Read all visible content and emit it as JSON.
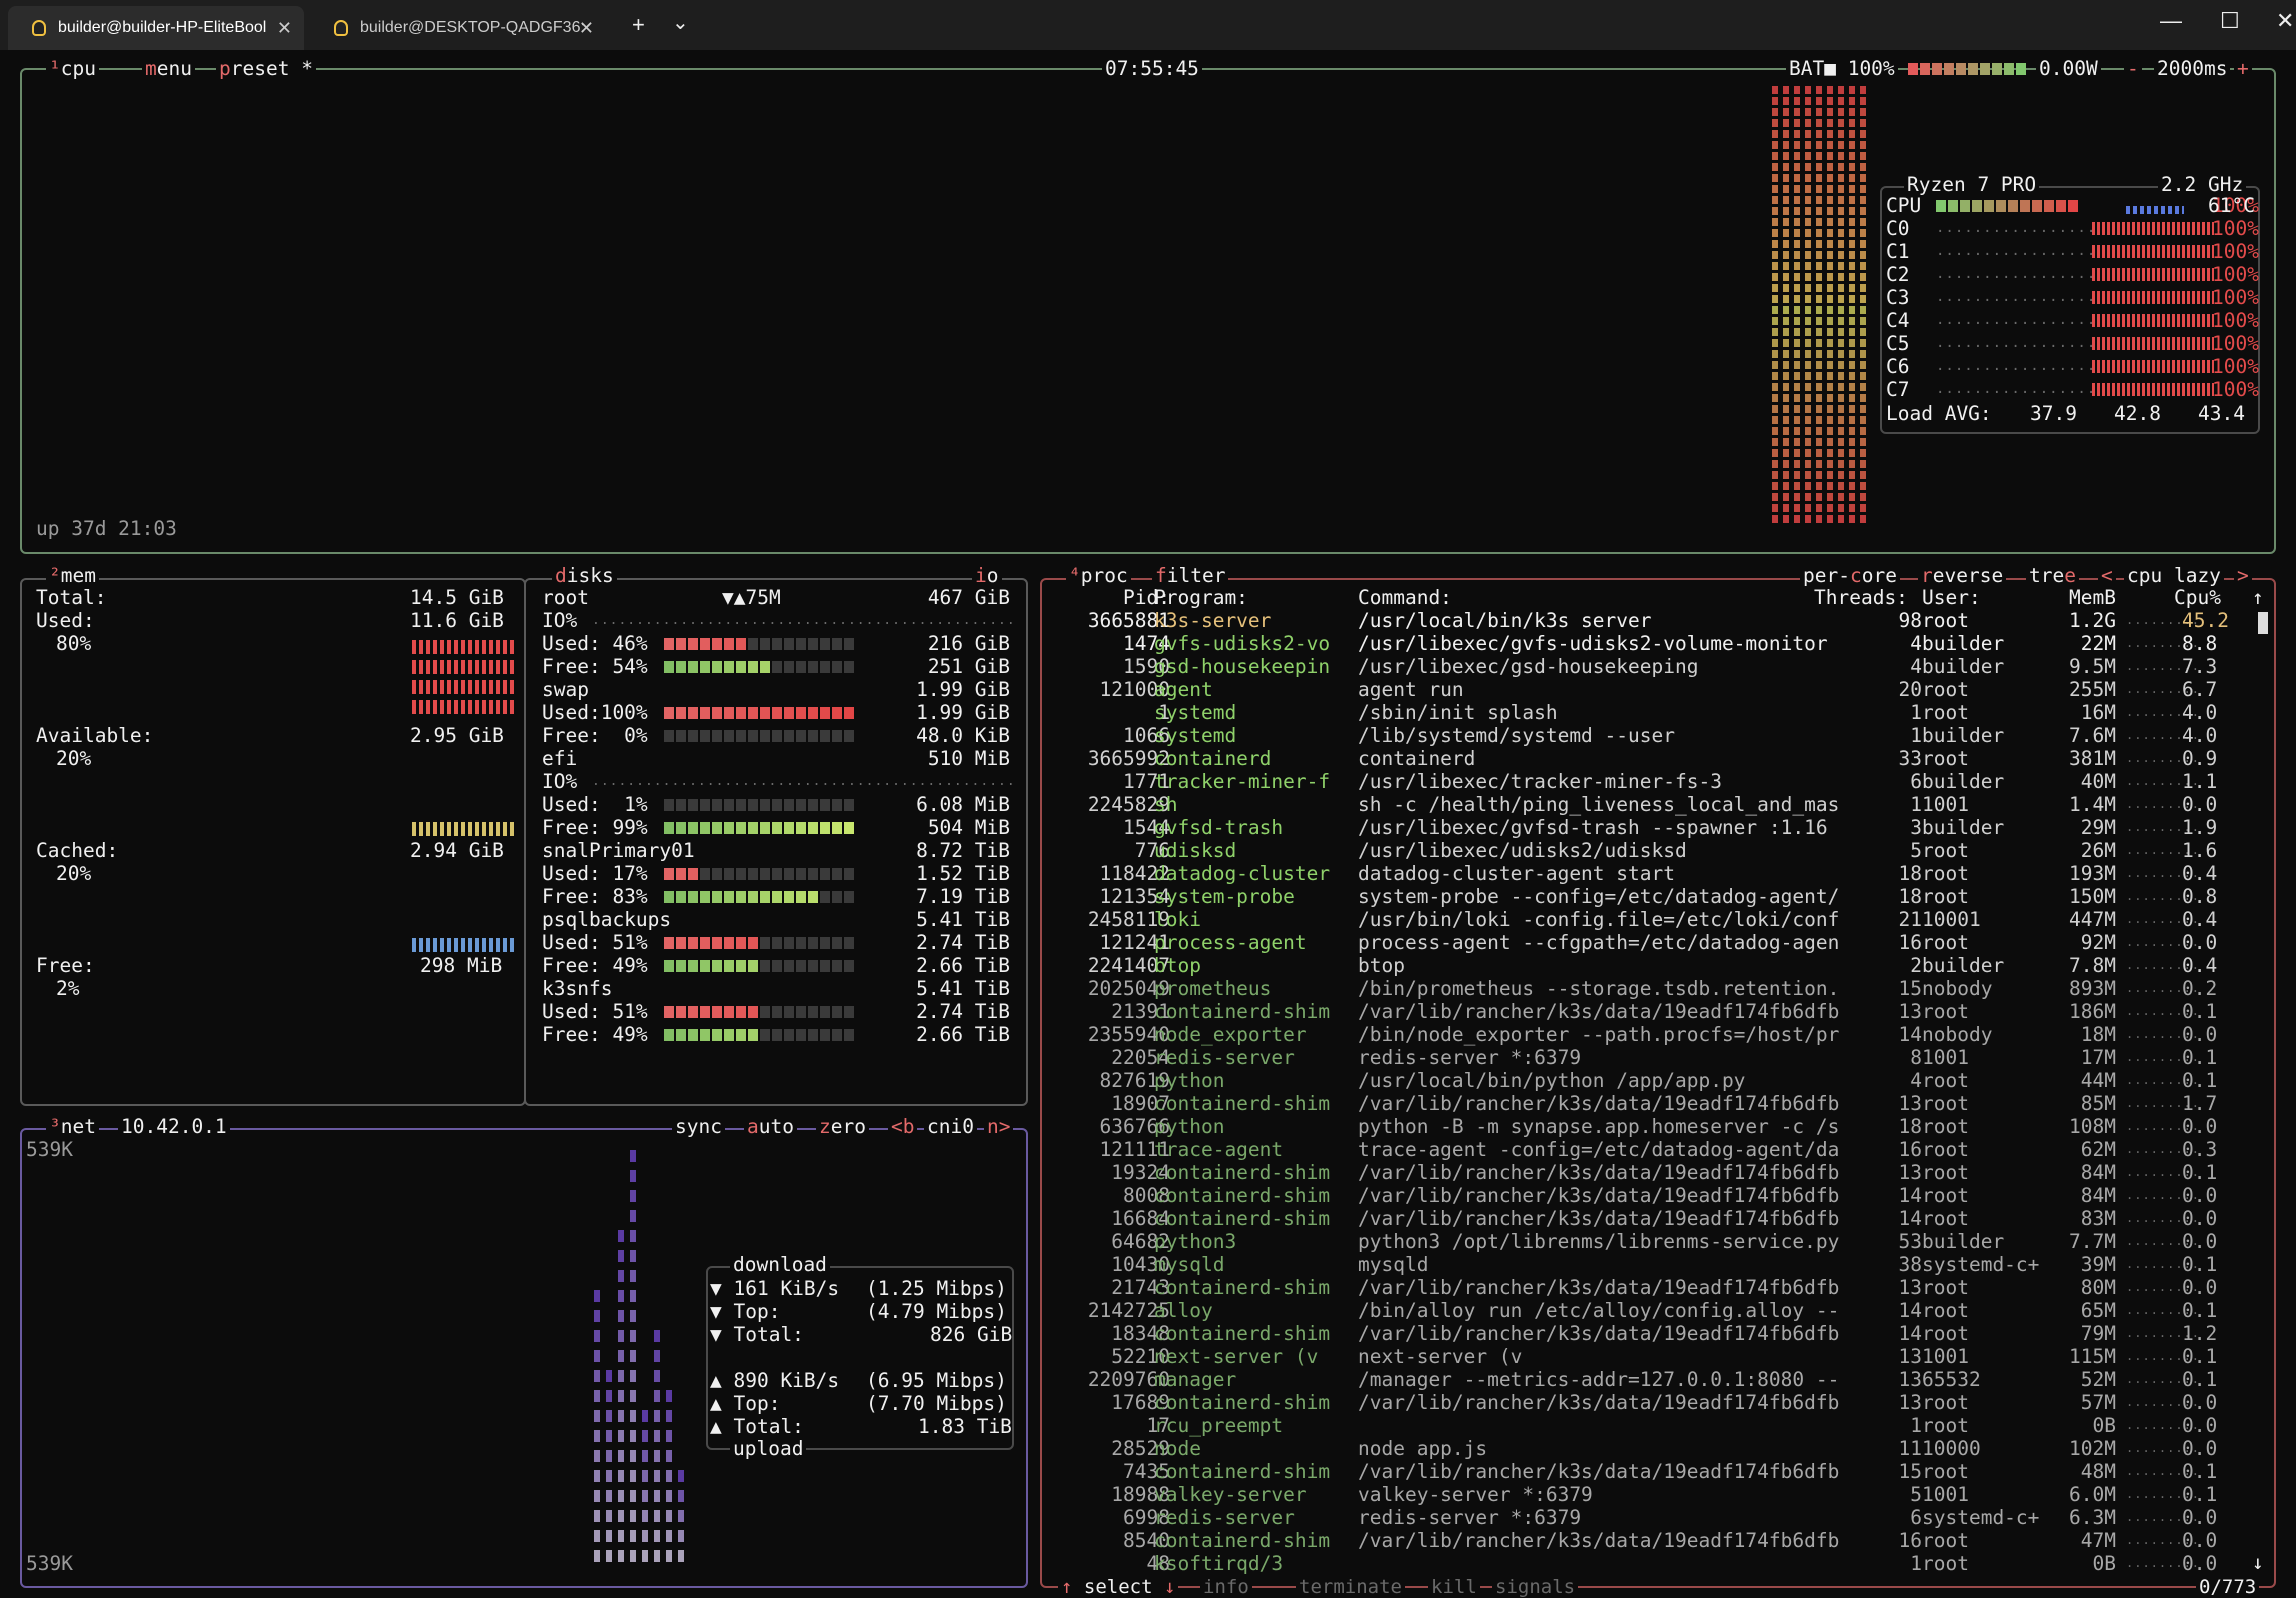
{
  "tabs": [
    {
      "label": "builder@builder-HP-EliteBool",
      "active": true
    },
    {
      "label": "builder@DESKTOP-QADGF36:",
      "active": false
    }
  ],
  "window": {
    "minimize": "—",
    "maximize": "☐",
    "close": "✕",
    "new_tab": "+",
    "dropdown": "⌄"
  },
  "cpu": {
    "title": "cpu",
    "menu": "menu",
    "preset": "preset *",
    "clock": "07:55:45",
    "battery": "BAT■ 100%",
    "power": "0.00W",
    "interval": "2000ms",
    "minus": "-",
    "plus": "+",
    "uptime": "up 37d 21:03",
    "model": "Ryzen 7 PRO",
    "freq": "2.2 GHz",
    "total_label": "CPU",
    "total_pct": "100%",
    "total_temp": "61°C",
    "cores": [
      {
        "name": "C0",
        "pct": "100%"
      },
      {
        "name": "C1",
        "pct": "100%"
      },
      {
        "name": "C2",
        "pct": "100%"
      },
      {
        "name": "C3",
        "pct": "100%"
      },
      {
        "name": "C4",
        "pct": "100%"
      },
      {
        "name": "C5",
        "pct": "100%"
      },
      {
        "name": "C6",
        "pct": "100%"
      },
      {
        "name": "C7",
        "pct": "100%"
      }
    ],
    "load_label": "Load AVG:",
    "load": [
      "37.9",
      "42.8",
      "43.4"
    ]
  },
  "mem": {
    "title": "mem",
    "total_label": "Total:",
    "total": "14.5 GiB",
    "used_label": "Used:",
    "used": "11.6 GiB",
    "used_pct": "80%",
    "avail_label": "Available:",
    "avail": "2.95 GiB",
    "avail_pct": "20%",
    "cached_label": "Cached:",
    "cached": "2.94 GiB",
    "cached_pct": "20%",
    "free_label": "Free:",
    "free": "298 MiB",
    "free_pct": "2%"
  },
  "disks": {
    "title": "disks",
    "io": "io",
    "root": {
      "name": "root",
      "io_speed": "▼▲75M",
      "size": "467 GiB",
      "io": "IO%",
      "used": "Used: 46%",
      "used_val": "216 GiB",
      "free": "Free: 54%",
      "free_val": "251 GiB",
      "used_frac": 0.46,
      "free_frac": 0.54
    },
    "swap": {
      "name": "swap",
      "size": "1.99 GiB",
      "used": "Used:100%",
      "used_val": "1.99 GiB",
      "free": "Free:  0%",
      "free_val": "48.0 KiB",
      "used_frac": 1.0,
      "free_frac": 0.0
    },
    "efi": {
      "name": "efi",
      "size": "510 MiB",
      "io": "IO%",
      "used": "Used:  1%",
      "used_val": "6.08 MiB",
      "free": "Free: 99%",
      "free_val": "504 MiB",
      "used_frac": 0.01,
      "free_frac": 0.99
    },
    "snal": {
      "name": "snalPrimary01",
      "size": "8.72 TiB",
      "used": "Used: 17%",
      "used_val": "1.52 TiB",
      "free": "Free: 83%",
      "free_val": "7.19 TiB",
      "used_frac": 0.17,
      "free_frac": 0.83
    },
    "psql": {
      "name": "psqlbackups",
      "size": "5.41 TiB",
      "used": "Used: 51%",
      "used_val": "2.74 TiB",
      "free": "Free: 49%",
      "free_val": "2.66 TiB",
      "used_frac": 0.51,
      "free_frac": 0.49
    },
    "k3s": {
      "name": "k3snfs",
      "size": "5.41 TiB",
      "used": "Used: 51%",
      "used_val": "2.74 TiB",
      "free": "Free: 49%",
      "free_val": "2.66 TiB",
      "used_frac": 0.51,
      "free_frac": 0.49
    }
  },
  "net": {
    "title": "net",
    "ip": "10.42.0.1",
    "sync": "sync",
    "auto": "auto",
    "zero": "zero",
    "prev": "<b",
    "iface": "cni0",
    "next": "n>",
    "scale_top": "539K",
    "scale_bottom": "539K",
    "download_label": "download",
    "dl_rate": "161 KiB/s",
    "dl_rate_bits": "(1.25 Mibps)",
    "dl_top_label": "Top:",
    "dl_top": "(4.79 Mibps)",
    "dl_total_label": "Total:",
    "dl_total": "826 GiB",
    "ul_rate": "890 KiB/s",
    "ul_rate_bits": "(6.95 Mibps)",
    "ul_top_label": "Top:",
    "ul_top": "(7.70 Mibps)",
    "ul_total_label": "Total:",
    "ul_total": "1.83 TiB",
    "upload_label": "upload"
  },
  "proc": {
    "title": "proc",
    "filter": "filter",
    "percore": "per-core",
    "reverse": "reverse",
    "tree": "tree",
    "sort": "cpu lazy",
    "sort_prev": "<",
    "sort_next": ">",
    "headers": {
      "pid": "Pid:",
      "program": "Program:",
      "command": "Command:",
      "threads": "Threads:",
      "user": "User:",
      "mem": "MemB",
      "cpu": "Cpu%"
    },
    "rows": [
      [
        "3665881",
        "k3s-server",
        "/usr/local/bin/k3s server",
        "98",
        "root",
        "1.2G",
        "45.2"
      ],
      [
        "1474",
        "gvfs-udisks2-vo",
        "/usr/libexec/gvfs-udisks2-volume-monitor",
        "4",
        "builder",
        "22M",
        "8.8"
      ],
      [
        "1590",
        "gsd-housekeepin",
        "/usr/libexec/gsd-housekeeping",
        "4",
        "builder",
        "9.5M",
        "7.3"
      ],
      [
        "121000",
        "agent",
        "agent run",
        "20",
        "root",
        "255M",
        "6.7"
      ],
      [
        "1",
        "systemd",
        "/sbin/init splash",
        "1",
        "root",
        "16M",
        "4.0"
      ],
      [
        "1066",
        "systemd",
        "/lib/systemd/systemd --user",
        "1",
        "builder",
        "7.6M",
        "4.0"
      ],
      [
        "3665992",
        "containerd",
        "containerd",
        "33",
        "root",
        "381M",
        "0.9"
      ],
      [
        "1771",
        "tracker-miner-f",
        "/usr/libexec/tracker-miner-fs-3",
        "6",
        "builder",
        "40M",
        "1.1"
      ],
      [
        "2245829",
        "sh",
        "sh -c /health/ping_liveness_local_and_mas",
        "1",
        "1001",
        "1.4M",
        "0.0"
      ],
      [
        "1544",
        "gvfsd-trash",
        "/usr/libexec/gvfsd-trash --spawner :1.16",
        "3",
        "builder",
        "29M",
        "1.9"
      ],
      [
        "776",
        "udisksd",
        "/usr/libexec/udisks2/udisksd",
        "5",
        "root",
        "26M",
        "1.6"
      ],
      [
        "118422",
        "datadog-cluster",
        "datadog-cluster-agent start",
        "18",
        "root",
        "193M",
        "0.4"
      ],
      [
        "121354",
        "system-probe",
        "system-probe --config=/etc/datadog-agent/",
        "18",
        "root",
        "150M",
        "0.8"
      ],
      [
        "2458119",
        "loki",
        "/usr/bin/loki -config.file=/etc/loki/conf",
        "21",
        "10001",
        "447M",
        "0.4"
      ],
      [
        "121241",
        "process-agent",
        "process-agent --cfgpath=/etc/datadog-agen",
        "16",
        "root",
        "92M",
        "0.0"
      ],
      [
        "2241407",
        "btop",
        "btop",
        "2",
        "builder",
        "7.8M",
        "0.4"
      ],
      [
        "2025049",
        "prometheus",
        "/bin/prometheus --storage.tsdb.retention.",
        "15",
        "nobody",
        "893M",
        "0.2"
      ],
      [
        "21391",
        "containerd-shim",
        "/var/lib/rancher/k3s/data/19eadf174fb6dfb",
        "13",
        "root",
        "186M",
        "0.1"
      ],
      [
        "2355940",
        "node_exporter",
        "/bin/node_exporter --path.procfs=/host/pr",
        "14",
        "nobody",
        "18M",
        "0.0"
      ],
      [
        "22054",
        "redis-server",
        "redis-server *:6379",
        "8",
        "1001",
        "17M",
        "0.1"
      ],
      [
        "827619",
        "python",
        "/usr/local/bin/python /app/app.py",
        "4",
        "root",
        "44M",
        "0.1"
      ],
      [
        "18907",
        "containerd-shim",
        "/var/lib/rancher/k3s/data/19eadf174fb6dfb",
        "13",
        "root",
        "85M",
        "1.7"
      ],
      [
        "636766",
        "python",
        "python -B -m synapse.app.homeserver -c /s",
        "18",
        "root",
        "108M",
        "0.0"
      ],
      [
        "121111",
        "trace-agent",
        "trace-agent -config=/etc/datadog-agent/da",
        "16",
        "root",
        "62M",
        "0.3"
      ],
      [
        "19324",
        "containerd-shim",
        "/var/lib/rancher/k3s/data/19eadf174fb6dfb",
        "13",
        "root",
        "84M",
        "0.1"
      ],
      [
        "8008",
        "containerd-shim",
        "/var/lib/rancher/k3s/data/19eadf174fb6dfb",
        "14",
        "root",
        "84M",
        "0.0"
      ],
      [
        "16684",
        "containerd-shim",
        "/var/lib/rancher/k3s/data/19eadf174fb6dfb",
        "14",
        "root",
        "83M",
        "0.0"
      ],
      [
        "64682",
        "python3",
        "python3 /opt/librenms/librenms-service.py",
        "53",
        "builder",
        "7.7M",
        "0.0"
      ],
      [
        "10430",
        "mysqld",
        "mysqld",
        "38",
        "systemd-c+",
        "39M",
        "0.1"
      ],
      [
        "21743",
        "containerd-shim",
        "/var/lib/rancher/k3s/data/19eadf174fb6dfb",
        "13",
        "root",
        "80M",
        "0.0"
      ],
      [
        "2142725",
        "alloy",
        "/bin/alloy run /etc/alloy/config.alloy --",
        "14",
        "root",
        "65M",
        "0.1"
      ],
      [
        "18348",
        "containerd-shim",
        "/var/lib/rancher/k3s/data/19eadf174fb6dfb",
        "14",
        "root",
        "79M",
        "1.2"
      ],
      [
        "52210",
        "next-server (v",
        "next-server (v",
        "13",
        "1001",
        "115M",
        "0.1"
      ],
      [
        "2209760",
        "manager",
        "/manager --metrics-addr=127.0.0.1:8080 --",
        "13",
        "65532",
        "52M",
        "0.1"
      ],
      [
        "17689",
        "containerd-shim",
        "/var/lib/rancher/k3s/data/19eadf174fb6dfb",
        "13",
        "root",
        "57M",
        "0.0"
      ],
      [
        "17",
        "rcu_preempt",
        "",
        "1",
        "root",
        "0B",
        "0.0"
      ],
      [
        "28529",
        "node",
        "node app.js",
        "11",
        "10000",
        "102M",
        "0.0"
      ],
      [
        "7435",
        "containerd-shim",
        "/var/lib/rancher/k3s/data/19eadf174fb6dfb",
        "15",
        "root",
        "48M",
        "0.1"
      ],
      [
        "18988",
        "valkey-server",
        "valkey-server *:6379",
        "5",
        "1001",
        "6.0M",
        "0.1"
      ],
      [
        "6998",
        "redis-server",
        "redis-server *:6379",
        "6",
        "systemd-c+",
        "6.3M",
        "0.0"
      ],
      [
        "8540",
        "containerd-shim",
        "/var/lib/rancher/k3s/data/19eadf174fb6dfb",
        "16",
        "root",
        "47M",
        "0.0"
      ],
      [
        "48",
        "ksoftirqd/3",
        "",
        "1",
        "root",
        "0B",
        "0.0"
      ]
    ],
    "footer": {
      "select": "select",
      "info": "info",
      "terminate": "terminate",
      "kill": "kill",
      "signals": "signals",
      "count": "0/773"
    }
  },
  "colors": {
    "accent": "#e36a6a",
    "label": "#ffffff",
    "panel_border": "#555555",
    "mem_used": "#e36a6a",
    "mem_avail": "#e0e0e0",
    "mem_cached": "#d6c26a",
    "mem_free": "#6a9ad6",
    "net": "#7c6ad6"
  }
}
